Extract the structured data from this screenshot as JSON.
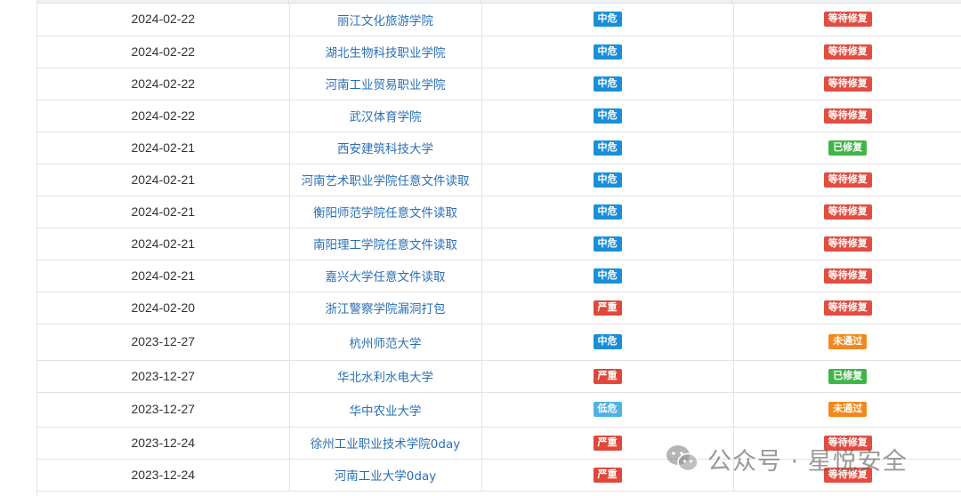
{
  "table": {
    "rows": [
      {
        "date": "2024-02-22",
        "name": "丽江文化旅游学院",
        "level": "中危",
        "level_kind": "mid",
        "status": "等待修复",
        "status_kind": "pending"
      },
      {
        "date": "2024-02-22",
        "name": "湖北生物科技职业学院",
        "level": "中危",
        "level_kind": "mid",
        "status": "等待修复",
        "status_kind": "pending"
      },
      {
        "date": "2024-02-22",
        "name": "河南工业贸易职业学院",
        "level": "中危",
        "level_kind": "mid",
        "status": "等待修复",
        "status_kind": "pending"
      },
      {
        "date": "2024-02-22",
        "name": "武汉体育学院",
        "level": "中危",
        "level_kind": "mid",
        "status": "等待修复",
        "status_kind": "pending"
      },
      {
        "date": "2024-02-21",
        "name": "西安建筑科技大学",
        "level": "中危",
        "level_kind": "mid",
        "status": "已修复",
        "status_kind": "fixed"
      },
      {
        "date": "2024-02-21",
        "name": "河南艺术职业学院任意文件读取",
        "level": "中危",
        "level_kind": "mid",
        "status": "等待修复",
        "status_kind": "pending"
      },
      {
        "date": "2024-02-21",
        "name": "衡阳师范学院任意文件读取",
        "level": "中危",
        "level_kind": "mid",
        "status": "等待修复",
        "status_kind": "pending"
      },
      {
        "date": "2024-02-21",
        "name": "南阳理工学院任意文件读取",
        "level": "中危",
        "level_kind": "mid",
        "status": "等待修复",
        "status_kind": "pending"
      },
      {
        "date": "2024-02-21",
        "name": "嘉兴大学任意文件读取",
        "level": "中危",
        "level_kind": "mid",
        "status": "等待修复",
        "status_kind": "pending"
      },
      {
        "date": "2024-02-20",
        "name": "浙江警察学院漏洞打包",
        "level": "严重",
        "level_kind": "severe",
        "status": "等待修复",
        "status_kind": "pending"
      },
      {
        "date": "2023-12-27",
        "name": "杭州师范大学",
        "level": "中危",
        "level_kind": "mid",
        "status": "未通过",
        "status_kind": "failed"
      },
      {
        "date": "2023-12-27",
        "name": "华北水利水电大学",
        "level": "严重",
        "level_kind": "severe",
        "status": "已修复",
        "status_kind": "fixed"
      },
      {
        "date": "2023-12-27",
        "name": "华中农业大学",
        "level": "低危",
        "level_kind": "low",
        "status": "未通过",
        "status_kind": "failed"
      },
      {
        "date": "2023-12-24",
        "name": "徐州工业职业技术学院0day",
        "level": "严重",
        "level_kind": "severe",
        "status": "等待修复",
        "status_kind": "pending"
      },
      {
        "date": "2023-12-24",
        "name": "河南工业大学0day",
        "level": "严重",
        "level_kind": "severe",
        "status": "等待修复",
        "status_kind": "pending"
      }
    ]
  },
  "watermark": {
    "text": "公众号 · 星悦安全",
    "icon": "wechat-icon"
  }
}
